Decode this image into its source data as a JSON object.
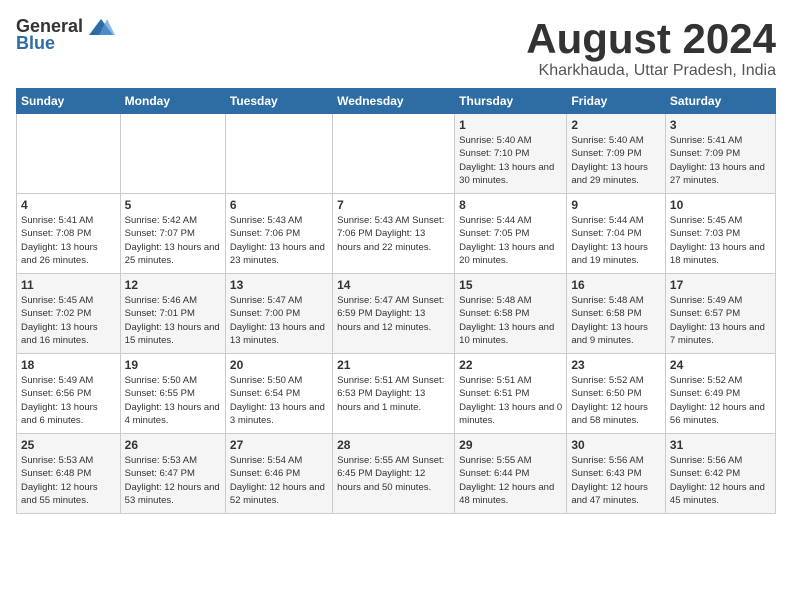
{
  "header": {
    "logo_general": "General",
    "logo_blue": "Blue",
    "title": "August 2024",
    "location": "Kharkhauda, Uttar Pradesh, India"
  },
  "days_of_week": [
    "Sunday",
    "Monday",
    "Tuesday",
    "Wednesday",
    "Thursday",
    "Friday",
    "Saturday"
  ],
  "weeks": [
    [
      {
        "day": "",
        "detail": ""
      },
      {
        "day": "",
        "detail": ""
      },
      {
        "day": "",
        "detail": ""
      },
      {
        "day": "",
        "detail": ""
      },
      {
        "day": "1",
        "detail": "Sunrise: 5:40 AM\nSunset: 7:10 PM\nDaylight: 13 hours\nand 30 minutes."
      },
      {
        "day": "2",
        "detail": "Sunrise: 5:40 AM\nSunset: 7:09 PM\nDaylight: 13 hours\nand 29 minutes."
      },
      {
        "day": "3",
        "detail": "Sunrise: 5:41 AM\nSunset: 7:09 PM\nDaylight: 13 hours\nand 27 minutes."
      }
    ],
    [
      {
        "day": "4",
        "detail": "Sunrise: 5:41 AM\nSunset: 7:08 PM\nDaylight: 13 hours\nand 26 minutes."
      },
      {
        "day": "5",
        "detail": "Sunrise: 5:42 AM\nSunset: 7:07 PM\nDaylight: 13 hours\nand 25 minutes."
      },
      {
        "day": "6",
        "detail": "Sunrise: 5:43 AM\nSunset: 7:06 PM\nDaylight: 13 hours\nand 23 minutes."
      },
      {
        "day": "7",
        "detail": "Sunrise: 5:43 AM\nSunset: 7:06 PM\nDaylight: 13 hours\nand 22 minutes."
      },
      {
        "day": "8",
        "detail": "Sunrise: 5:44 AM\nSunset: 7:05 PM\nDaylight: 13 hours\nand 20 minutes."
      },
      {
        "day": "9",
        "detail": "Sunrise: 5:44 AM\nSunset: 7:04 PM\nDaylight: 13 hours\nand 19 minutes."
      },
      {
        "day": "10",
        "detail": "Sunrise: 5:45 AM\nSunset: 7:03 PM\nDaylight: 13 hours\nand 18 minutes."
      }
    ],
    [
      {
        "day": "11",
        "detail": "Sunrise: 5:45 AM\nSunset: 7:02 PM\nDaylight: 13 hours\nand 16 minutes."
      },
      {
        "day": "12",
        "detail": "Sunrise: 5:46 AM\nSunset: 7:01 PM\nDaylight: 13 hours\nand 15 minutes."
      },
      {
        "day": "13",
        "detail": "Sunrise: 5:47 AM\nSunset: 7:00 PM\nDaylight: 13 hours\nand 13 minutes."
      },
      {
        "day": "14",
        "detail": "Sunrise: 5:47 AM\nSunset: 6:59 PM\nDaylight: 13 hours\nand 12 minutes."
      },
      {
        "day": "15",
        "detail": "Sunrise: 5:48 AM\nSunset: 6:58 PM\nDaylight: 13 hours\nand 10 minutes."
      },
      {
        "day": "16",
        "detail": "Sunrise: 5:48 AM\nSunset: 6:58 PM\nDaylight: 13 hours\nand 9 minutes."
      },
      {
        "day": "17",
        "detail": "Sunrise: 5:49 AM\nSunset: 6:57 PM\nDaylight: 13 hours\nand 7 minutes."
      }
    ],
    [
      {
        "day": "18",
        "detail": "Sunrise: 5:49 AM\nSunset: 6:56 PM\nDaylight: 13 hours\nand 6 minutes."
      },
      {
        "day": "19",
        "detail": "Sunrise: 5:50 AM\nSunset: 6:55 PM\nDaylight: 13 hours\nand 4 minutes."
      },
      {
        "day": "20",
        "detail": "Sunrise: 5:50 AM\nSunset: 6:54 PM\nDaylight: 13 hours\nand 3 minutes."
      },
      {
        "day": "21",
        "detail": "Sunrise: 5:51 AM\nSunset: 6:53 PM\nDaylight: 13 hours\nand 1 minute."
      },
      {
        "day": "22",
        "detail": "Sunrise: 5:51 AM\nSunset: 6:51 PM\nDaylight: 13 hours\nand 0 minutes."
      },
      {
        "day": "23",
        "detail": "Sunrise: 5:52 AM\nSunset: 6:50 PM\nDaylight: 12 hours\nand 58 minutes."
      },
      {
        "day": "24",
        "detail": "Sunrise: 5:52 AM\nSunset: 6:49 PM\nDaylight: 12 hours\nand 56 minutes."
      }
    ],
    [
      {
        "day": "25",
        "detail": "Sunrise: 5:53 AM\nSunset: 6:48 PM\nDaylight: 12 hours\nand 55 minutes."
      },
      {
        "day": "26",
        "detail": "Sunrise: 5:53 AM\nSunset: 6:47 PM\nDaylight: 12 hours\nand 53 minutes."
      },
      {
        "day": "27",
        "detail": "Sunrise: 5:54 AM\nSunset: 6:46 PM\nDaylight: 12 hours\nand 52 minutes."
      },
      {
        "day": "28",
        "detail": "Sunrise: 5:55 AM\nSunset: 6:45 PM\nDaylight: 12 hours\nand 50 minutes."
      },
      {
        "day": "29",
        "detail": "Sunrise: 5:55 AM\nSunset: 6:44 PM\nDaylight: 12 hours\nand 48 minutes."
      },
      {
        "day": "30",
        "detail": "Sunrise: 5:56 AM\nSunset: 6:43 PM\nDaylight: 12 hours\nand 47 minutes."
      },
      {
        "day": "31",
        "detail": "Sunrise: 5:56 AM\nSunset: 6:42 PM\nDaylight: 12 hours\nand 45 minutes."
      }
    ]
  ]
}
